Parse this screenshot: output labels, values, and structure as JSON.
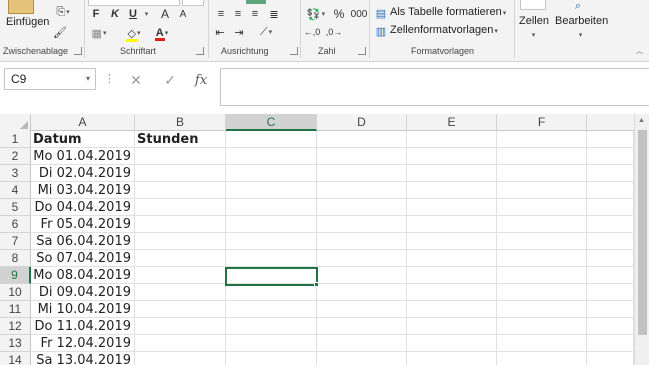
{
  "ribbon": {
    "paste_label": "Einfügen",
    "bold": "F",
    "italic": "K",
    "underline": "U",
    "font_grow": "A",
    "font_shrink": "A",
    "font_color_letter": "A",
    "percent": "%",
    "thousands": "000",
    "as_table_label": "Als Tabelle formatieren",
    "cell_styles_label": "Zellenformatvorlagen",
    "cells_label": "Zellen",
    "edit_label": "Bearbeiten",
    "groups": {
      "clipboard": "Zwischenablage",
      "font": "Schriftart",
      "alignment": "Ausrichtung",
      "number": "Zahl",
      "styles": "Formatvorlagen"
    },
    "font_color_hex": "#e0201b",
    "highlight_color_hex": "#ffff00"
  },
  "formula_bar": {
    "name_box": "C9",
    "cancel_symbol": "✕",
    "enter_symbol": "✓",
    "fx_symbol": "fx",
    "formula": ""
  },
  "sheet": {
    "columns": [
      "A",
      "B",
      "C",
      "D",
      "E",
      "F"
    ],
    "active_column": "C",
    "active_row": 9,
    "rows": [
      {
        "n": "1",
        "a": "Datum",
        "b": "Stunden"
      },
      {
        "n": "2",
        "a": "Mo 01.04.2019",
        "b": ""
      },
      {
        "n": "3",
        "a": "Di 02.04.2019",
        "b": ""
      },
      {
        "n": "4",
        "a": "Mi 03.04.2019",
        "b": ""
      },
      {
        "n": "5",
        "a": "Do 04.04.2019",
        "b": ""
      },
      {
        "n": "6",
        "a": "Fr 05.04.2019",
        "b": ""
      },
      {
        "n": "7",
        "a": "Sa 06.04.2019",
        "b": ""
      },
      {
        "n": "8",
        "a": "So 07.04.2019",
        "b": ""
      },
      {
        "n": "9",
        "a": "Mo 08.04.2019",
        "b": ""
      },
      {
        "n": "10",
        "a": "Di 09.04.2019",
        "b": ""
      },
      {
        "n": "11",
        "a": "Mi 10.04.2019",
        "b": ""
      },
      {
        "n": "12",
        "a": "Do 11.04.2019",
        "b": ""
      },
      {
        "n": "13",
        "a": "Fr 12.04.2019",
        "b": ""
      },
      {
        "n": "14",
        "a": "Sa 13.04.2019",
        "b": ""
      }
    ]
  },
  "colors": {
    "accent": "#217346",
    "header_bg": "#f3f3f3",
    "active_header_bg": "#d2d2d2"
  }
}
